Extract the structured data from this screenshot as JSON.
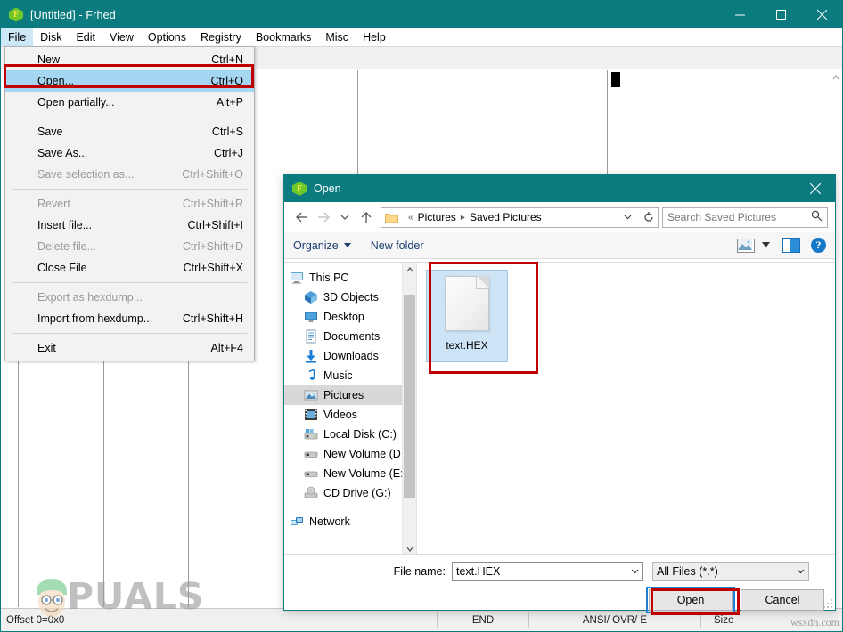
{
  "app": {
    "title": "[Untitled] - Frhed",
    "icon": "frhed-hex-icon",
    "icon_letter": "F"
  },
  "window_controls": {
    "minimize": "minimize-icon",
    "maximize": "maximize-icon",
    "close": "close-icon"
  },
  "menubar": {
    "items": [
      {
        "label": "File",
        "active": true
      },
      {
        "label": "Disk",
        "active": false
      },
      {
        "label": "Edit",
        "active": false
      },
      {
        "label": "View",
        "active": false
      },
      {
        "label": "Options",
        "active": false
      },
      {
        "label": "Registry",
        "active": false
      },
      {
        "label": "Bookmarks",
        "active": false
      },
      {
        "label": "Misc",
        "active": false
      },
      {
        "label": "Help",
        "active": false
      }
    ]
  },
  "file_menu": {
    "items": [
      {
        "label": "New",
        "accel": "Ctrl+N",
        "disabled": false,
        "highlight": false,
        "separator_after": false
      },
      {
        "label": "Open...",
        "accel": "Ctrl+O",
        "disabled": false,
        "highlight": true,
        "separator_after": false
      },
      {
        "label": "Open partially...",
        "accel": "Alt+P",
        "disabled": false,
        "highlight": false,
        "separator_after": true
      },
      {
        "label": "Save",
        "accel": "Ctrl+S",
        "disabled": false,
        "highlight": false,
        "separator_after": false
      },
      {
        "label": "Save As...",
        "accel": "Ctrl+J",
        "disabled": false,
        "highlight": false,
        "separator_after": false
      },
      {
        "label": "Save selection as...",
        "accel": "Ctrl+Shift+O",
        "disabled": true,
        "highlight": false,
        "separator_after": true
      },
      {
        "label": "Revert",
        "accel": "Ctrl+Shift+R",
        "disabled": true,
        "highlight": false,
        "separator_after": false
      },
      {
        "label": "Insert file...",
        "accel": "Ctrl+Shift+I",
        "disabled": false,
        "highlight": false,
        "separator_after": false
      },
      {
        "label": "Delete file...",
        "accel": "Ctrl+Shift+D",
        "disabled": true,
        "highlight": false,
        "separator_after": false
      },
      {
        "label": "Close File",
        "accel": "Ctrl+Shift+X",
        "disabled": false,
        "highlight": false,
        "separator_after": true
      },
      {
        "label": "Export as hexdump...",
        "accel": "",
        "disabled": true,
        "highlight": false,
        "separator_after": false
      },
      {
        "label": "Import from hexdump...",
        "accel": "Ctrl+Shift+H",
        "disabled": false,
        "highlight": false,
        "separator_after": true
      },
      {
        "label": "Exit",
        "accel": "Alt+F4",
        "disabled": false,
        "highlight": false,
        "separator_after": false
      }
    ]
  },
  "toolbar": {
    "icons": [
      "fast-forward-icon",
      "step-forward-icon"
    ]
  },
  "status_bar": {
    "offset": "Offset 0=0x0",
    "end": "END",
    "mode": "ANSI/ OVR/ E",
    "size": "Size"
  },
  "watermark": {
    "text": "PUALS",
    "full": "APPUALS"
  },
  "site_mark": "wsxdn.com",
  "dialog": {
    "title": "Open",
    "icon": "frhed-hex-icon",
    "close": "close-icon",
    "nav": {
      "back": "back-arrow-icon",
      "forward": "forward-arrow-icon",
      "recent": "chevron-down-icon",
      "up": "up-arrow-icon",
      "breadcrumb_prefix": "«",
      "breadcrumbs": [
        "Pictures",
        "Saved Pictures"
      ],
      "dropdown": "chevron-down-icon",
      "refresh": "refresh-icon",
      "search_placeholder": "Search Saved Pictures",
      "search_value": "",
      "search_icon": "search-icon"
    },
    "toolbar": {
      "organize": "Organize",
      "new_folder": "New folder",
      "view_icon": "view-mode-icon",
      "view_caret": "chevron-down-icon",
      "preview_pane_icon": "preview-pane-icon",
      "help_icon": "help-icon",
      "help_glyph": "?"
    },
    "nav_pane": {
      "items": [
        {
          "label": "This PC",
          "icon": "this-pc-icon",
          "indent": false,
          "selected": false
        },
        {
          "label": "3D Objects",
          "icon": "3d-objects-icon",
          "indent": true,
          "selected": false
        },
        {
          "label": "Desktop",
          "icon": "desktop-icon",
          "indent": true,
          "selected": false
        },
        {
          "label": "Documents",
          "icon": "documents-icon",
          "indent": true,
          "selected": false
        },
        {
          "label": "Downloads",
          "icon": "downloads-icon",
          "indent": true,
          "selected": false
        },
        {
          "label": "Music",
          "icon": "music-icon",
          "indent": true,
          "selected": false
        },
        {
          "label": "Pictures",
          "icon": "pictures-icon",
          "indent": true,
          "selected": true
        },
        {
          "label": "Videos",
          "icon": "videos-icon",
          "indent": true,
          "selected": false
        },
        {
          "label": "Local Disk (C:)",
          "icon": "local-disk-icon",
          "indent": true,
          "selected": false
        },
        {
          "label": "New Volume (D:)",
          "icon": "drive-icon",
          "indent": true,
          "selected": false
        },
        {
          "label": "New Volume (E:)",
          "icon": "drive-icon",
          "indent": true,
          "selected": false
        },
        {
          "label": "CD Drive (G:)",
          "icon": "cd-drive-icon",
          "indent": true,
          "selected": false
        },
        {
          "label": "Network",
          "icon": "network-icon",
          "indent": false,
          "selected": false
        }
      ]
    },
    "files": [
      {
        "name": "text.HEX",
        "icon": "document-file-icon",
        "selected": true
      }
    ],
    "footer": {
      "file_name_label": "File name:",
      "file_name_value": "text.HEX",
      "file_name_chevron": "chevron-down-icon",
      "filter_value": "All Files (*.*)",
      "filter_chevron": "chevron-down-icon",
      "open_button": "Open",
      "cancel_button": "Cancel"
    }
  },
  "colors": {
    "title_teal": "#0b7b7f",
    "menu_highlight": "#a5d7f2",
    "annotation_red": "#c00000",
    "focus_blue": "#1e7fd4",
    "selection_blue": "#cde4f7"
  }
}
